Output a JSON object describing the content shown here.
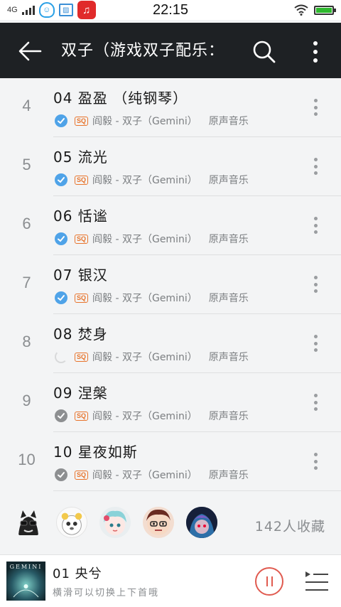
{
  "status_bar": {
    "network": "4G",
    "time": "22:15"
  },
  "header": {
    "title": "双子（游戏双子配乐：",
    "back_icon": "arrow-left-icon",
    "search_icon": "search-icon",
    "more_icon": "more-vertical-icon"
  },
  "tracks": [
    {
      "index": "4",
      "title": "04 盈盈 （纯钢琴）",
      "quality": "SQ",
      "artist": "阎毅 - 双子（Gemini）",
      "album": "原声音乐",
      "status": "downloaded"
    },
    {
      "index": "5",
      "title": "05 流光",
      "quality": "SQ",
      "artist": "阎毅 - 双子（Gemini）",
      "album": "原声音乐",
      "status": "downloaded"
    },
    {
      "index": "6",
      "title": "06 恬谧",
      "quality": "SQ",
      "artist": "阎毅 - 双子（Gemini）",
      "album": "原声音乐",
      "status": "downloaded"
    },
    {
      "index": "7",
      "title": "07 银汉",
      "quality": "SQ",
      "artist": "阎毅 - 双子（Gemini）",
      "album": "原声音乐",
      "status": "downloaded"
    },
    {
      "index": "8",
      "title": "08 焚身",
      "quality": "SQ",
      "artist": "阎毅 - 双子（Gemini）",
      "album": "原声音乐",
      "status": "downloading"
    },
    {
      "index": "9",
      "title": "09 涅槃",
      "quality": "SQ",
      "artist": "阎毅 - 双子（Gemini）",
      "album": "原声音乐",
      "status": "cached"
    },
    {
      "index": "10",
      "title": "10 星夜如斯",
      "quality": "SQ",
      "artist": "阎毅 - 双子（Gemini）",
      "album": "原声音乐",
      "status": "cached"
    }
  ],
  "collectors": {
    "avatars": [
      "avatar-cat",
      "avatar-panda",
      "avatar-anime-girl",
      "avatar-cartoon-face",
      "avatar-lol-character"
    ],
    "count_label": "142人收藏"
  },
  "player": {
    "cover_text": "GEMINI",
    "now_playing": "01 央兮",
    "hint": "横滑可以切换上下首哦"
  },
  "colors": {
    "header_bg": "#1e2124",
    "downloaded": "#4fa3e8",
    "sq_badge": "#e8742c",
    "pause_accent": "#e05a4f"
  }
}
